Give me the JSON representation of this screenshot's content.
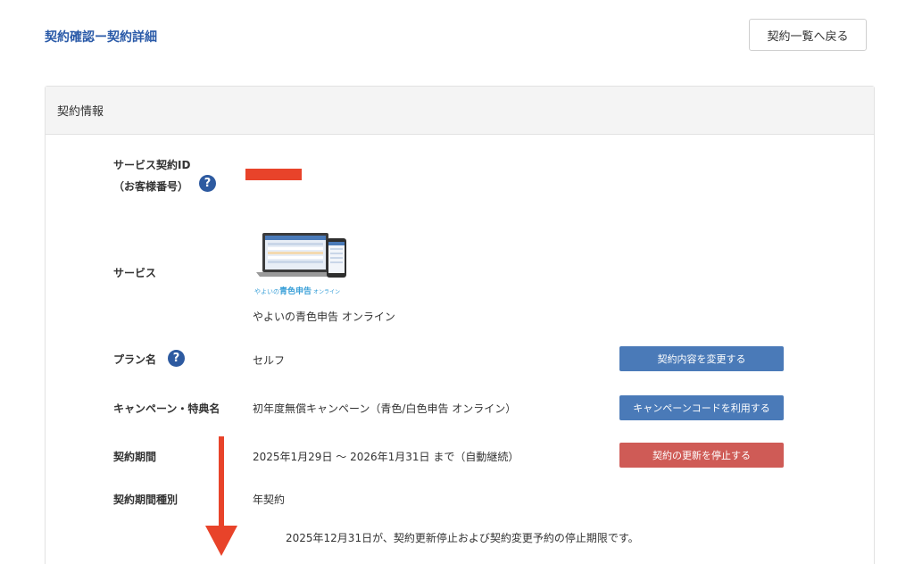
{
  "page": {
    "title": "契約確認ー契約詳細",
    "back_button": "契約一覧へ戻る"
  },
  "panel": {
    "header": "契約情報"
  },
  "rows": {
    "contract_id": {
      "label_line1": "サービス契約ID",
      "label_line2": "（お客様番号）",
      "help_icon": "question-circle-icon"
    },
    "service": {
      "label": "サービス",
      "logo_caption_prefix": "やよいの",
      "logo_caption_main": "青色申告",
      "logo_caption_suffix": "オンライン",
      "value": "やよいの青色申告 オンライン"
    },
    "plan": {
      "label": "プラン名",
      "help_icon": "question-circle-icon",
      "value": "セルフ",
      "button": "契約内容を変更する"
    },
    "campaign": {
      "label": "キャンペーン・特典名",
      "value": "初年度無償キャンペーン（青色/白色申告 オンライン）",
      "button": "キャンペーンコードを利用する"
    },
    "period": {
      "label": "契約期間",
      "value": "2025年1月29日 〜 2026年1月31日 まで（自動継続）",
      "button": "契約の更新を停止する"
    },
    "period_type": {
      "label": "契約期間種別",
      "value": "年契約"
    },
    "notice": "2025年12月31日が、契約更新停止および契約変更予約の停止期限です。"
  },
  "colors": {
    "title": "#2a5aa8",
    "button_blue": "#4a7ab8",
    "button_red": "#cf5b56",
    "redaction": "#e8432a",
    "annotation_arrow": "#e8432a"
  }
}
